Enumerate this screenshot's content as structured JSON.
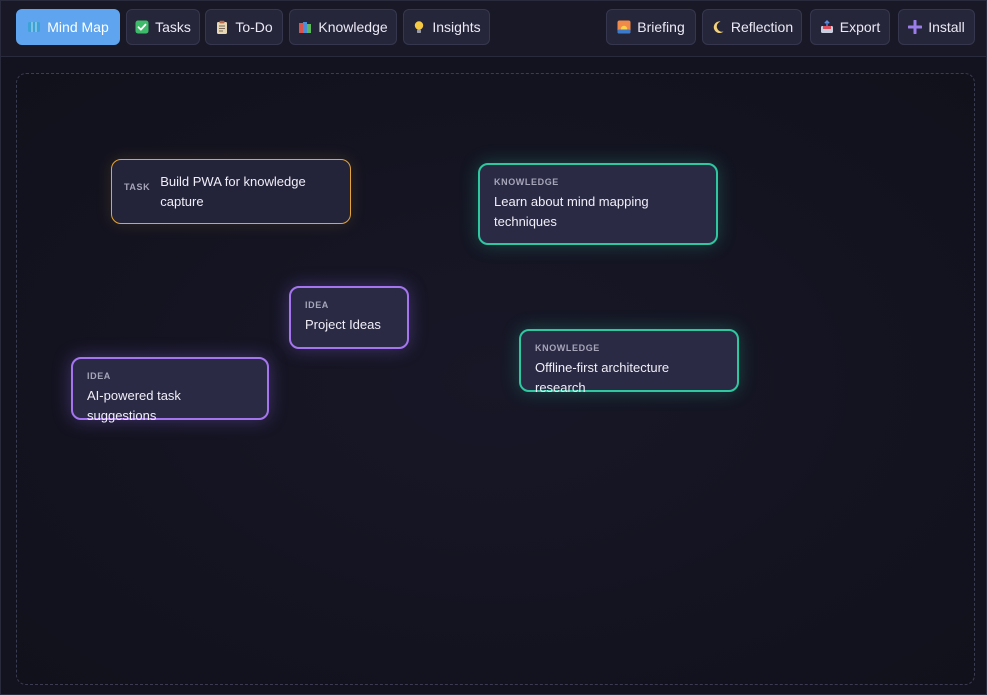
{
  "toolbar": {
    "left_buttons": [
      {
        "label": "Mind Map",
        "icon": "map-icon",
        "active": true
      },
      {
        "label": "Tasks",
        "icon": "checkbox-icon",
        "active": false
      },
      {
        "label": "To-Do",
        "icon": "clipboard-icon",
        "active": false
      },
      {
        "label": "Knowledge",
        "icon": "books-icon",
        "active": false
      },
      {
        "label": "Insights",
        "icon": "lightbulb-icon",
        "active": false
      }
    ],
    "right_buttons": [
      {
        "label": "Briefing",
        "icon": "sunrise-icon"
      },
      {
        "label": "Reflection",
        "icon": "moon-icon"
      },
      {
        "label": "Export",
        "icon": "outbox-icon"
      },
      {
        "label": "Install",
        "icon": "plus-icon"
      }
    ]
  },
  "nodes": [
    {
      "type": "TASK",
      "text": "Build PWA for knowledge capture"
    },
    {
      "type": "KNOWLEDGE",
      "text": "Learn about mind mapping techniques"
    },
    {
      "type": "IDEA",
      "text": "Project Ideas"
    },
    {
      "type": "KNOWLEDGE",
      "text": "Offline-first architecture research"
    },
    {
      "type": "IDEA",
      "text": "AI-powered task suggestions"
    }
  ],
  "colors": {
    "active_tab": "#5ea4ee",
    "idea_border": "#a575ef",
    "knowledge_border": "#2fc7a0",
    "task_border": "#e3a43a"
  }
}
